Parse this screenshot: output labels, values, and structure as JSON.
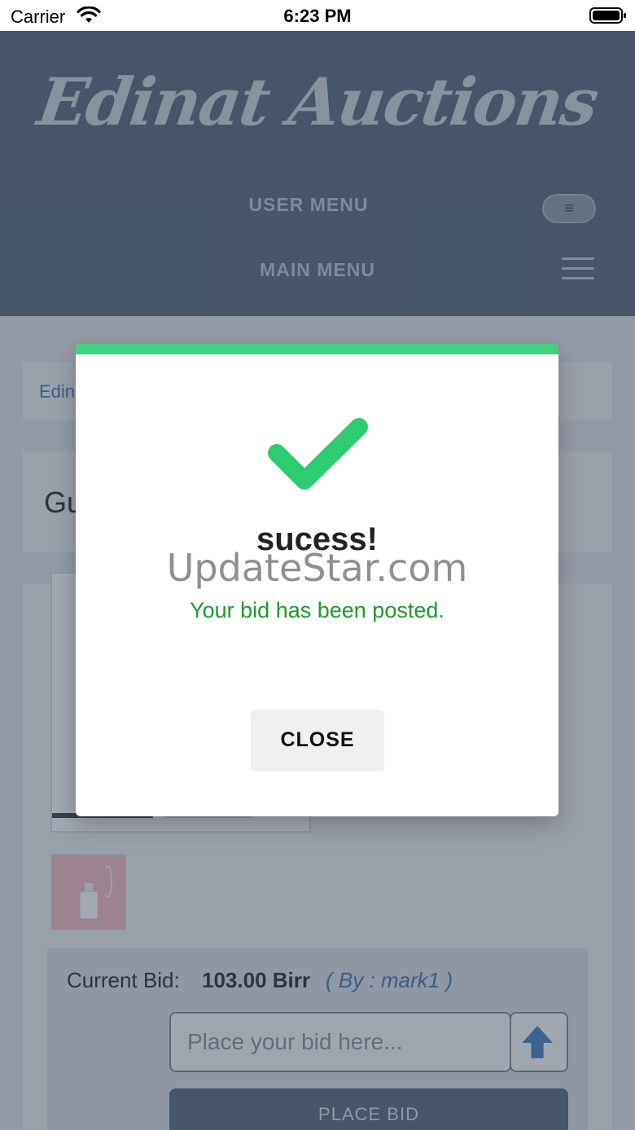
{
  "status_bar": {
    "carrier": "Carrier",
    "time": "6:23 PM"
  },
  "header": {
    "logo_text": "Edinat Auctions",
    "user_menu_label": "USER MENU",
    "user_menu_toggle_icon": "≡",
    "main_menu_label": "MAIN MENU"
  },
  "page": {
    "breadcrumb_partial": "Edin",
    "title_partial": "Gu",
    "current_bid_label": "Current Bid:",
    "current_bid_amount": "103.00 Birr",
    "current_bid_by": "( By : mark1 )",
    "bid_input_placeholder": "Place your bid here...",
    "place_bid_label": "PLACE BID"
  },
  "modal": {
    "title": "sucess!",
    "watermark": "UpdateStar.com",
    "message": "Your bid has been posted.",
    "close_label": "CLOSE",
    "accent_color": "#3fd27e",
    "check_color": "#2ecc71",
    "message_color": "#1f9a2c"
  },
  "icons": {
    "wifi": "wifi-icon",
    "battery": "battery-icon",
    "hamburger": "hamburger-icon",
    "check": "checkmark-icon",
    "arrow_up": "arrow-up-icon"
  }
}
